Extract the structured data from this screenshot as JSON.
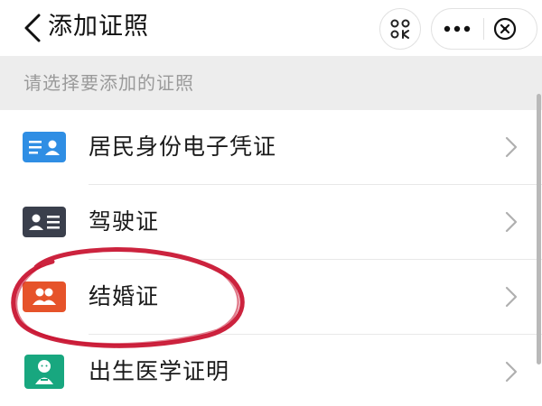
{
  "header": {
    "title": "添加证照",
    "back_icon": "chevron-left-icon",
    "scan_icon": "scan-icon",
    "more_icon": "more-dots-icon",
    "close_icon": "close-circle-icon"
  },
  "hint": "请选择要添加的证照",
  "items": [
    {
      "label": "居民身份电子凭证",
      "icon": "id-card-icon",
      "color": "#2f8ee4"
    },
    {
      "label": "驾驶证",
      "icon": "driver-license-icon",
      "color": "#3a3f4c"
    },
    {
      "label": "结婚证",
      "icon": "couple-icon",
      "color": "#e6532a"
    },
    {
      "label": "出生医学证明",
      "icon": "baby-certificate-icon",
      "color": "#18a77f"
    }
  ],
  "colors": {
    "background": "#ededed",
    "surface": "#ffffff",
    "text_primary": "#1a1a1a",
    "text_hint": "#9a9a9a",
    "annotation": "#c8102e"
  }
}
